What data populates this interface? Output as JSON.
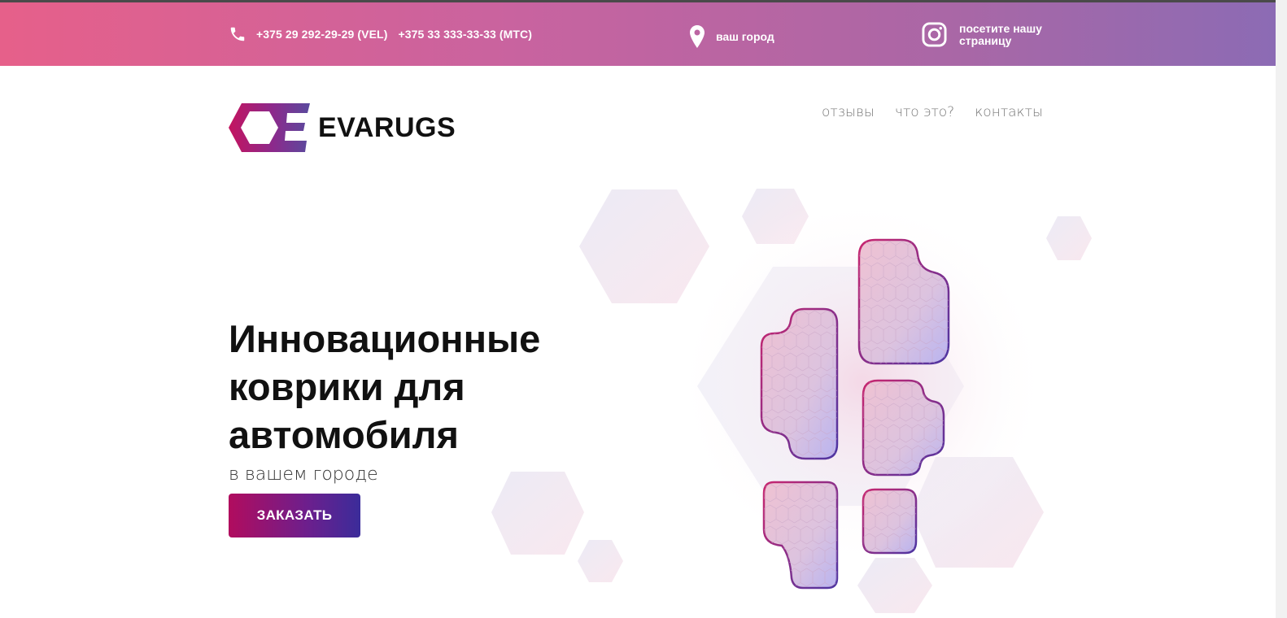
{
  "topbar": {
    "phone1": "+375 29 292-29-29 (VEL)",
    "phone2": "+375 33 333-33-33 (MTC)",
    "city": "ваш город",
    "instagram_label": "посетите нашу страницу"
  },
  "brand": {
    "name": "EVARUGS"
  },
  "nav": {
    "items": [
      "отзывы",
      "что это?",
      "контакты"
    ]
  },
  "hero": {
    "title": "Инновационные коврики для автомобиля",
    "subtitle": "в вашем городе",
    "cta": "ЗАКАЗАТЬ"
  },
  "colors": {
    "accent_pink": "#e6608a",
    "accent_purple": "#8c6bb4",
    "button_start": "#b10c5e",
    "button_end": "#3b2c9a"
  }
}
